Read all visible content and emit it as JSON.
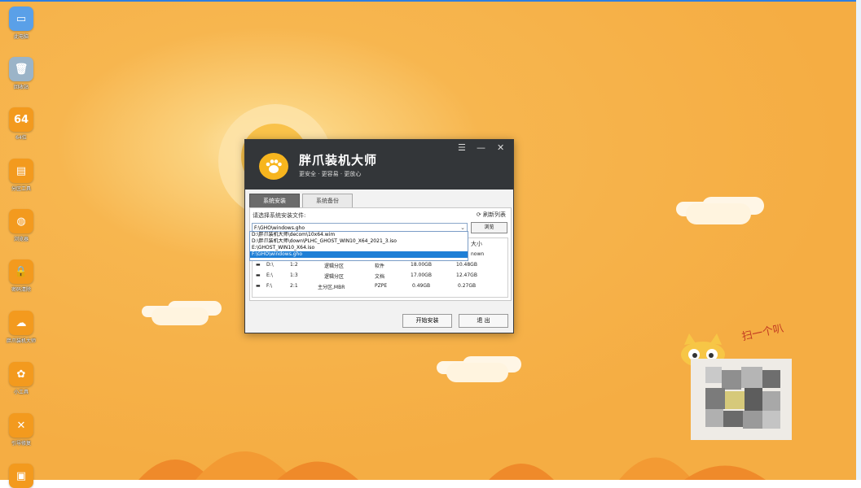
{
  "desktop_icons": [
    {
      "label": "此电脑",
      "icon": "computer-icon",
      "glyph": "▭"
    },
    {
      "label": "回收站",
      "icon": "recycle-bin-icon",
      "glyph": "🗑"
    },
    {
      "label": "64位",
      "icon": "64bit-icon",
      "glyph": "64"
    },
    {
      "label": "分区工具",
      "icon": "disk-icon",
      "glyph": "▤"
    },
    {
      "label": "浏览器",
      "icon": "globe-icon",
      "glyph": "◍"
    },
    {
      "label": "密码清除",
      "icon": "lock-icon",
      "glyph": "🔒"
    },
    {
      "label": "胖爪装机大师",
      "icon": "paw-icon",
      "glyph": "☁"
    },
    {
      "label": "小工具",
      "icon": "leaf-icon",
      "glyph": "✿"
    },
    {
      "label": "引导修复",
      "icon": "tools-icon",
      "glyph": "✕"
    },
    {
      "label": "远程",
      "icon": "remote-icon",
      "glyph": "▣"
    }
  ],
  "window": {
    "title": "胖爪装机大师",
    "subtitle": "更安全 · 更容易 · 更放心",
    "tabs": [
      {
        "label": "系统安装",
        "active": true
      },
      {
        "label": "系统备份",
        "active": false
      }
    ],
    "prompt": "请选择系统安装文件:",
    "refresh_label": "刷新列表",
    "combo_value": "F:\\GHO\\windows.gho",
    "browse_label": "浏览",
    "dropdown_options": [
      "D:\\胖爪装机大师\\decom\\10x64.wim",
      "D:\\胖爪装机大师\\down\\PLHC_GHOST_WIN10_X64_2021_3.iso",
      "E:\\GHOST_WIN10_X64.iso",
      "F:\\GHO\\windows.gho"
    ],
    "dropdown_selected": 3,
    "table_header_size": "大小",
    "table_partial_row": "nown",
    "table_rows": [
      {
        "drive": "D:\\",
        "index": "1:2",
        "type": "逻辑分区",
        "label": "软件",
        "total": "18.00GB",
        "free": "10.48GB"
      },
      {
        "drive": "E:\\",
        "index": "1:3",
        "type": "逻辑分区",
        "label": "文档",
        "total": "17.00GB",
        "free": "12.47GB"
      },
      {
        "drive": "F:\\",
        "index": "2:1",
        "type": "主分区,MBR",
        "label": "PZPE",
        "total": "0.49GB",
        "free": "0.27GB"
      }
    ],
    "start_button": "开始安装",
    "exit_button": "退 出"
  },
  "wallpaper": {
    "handwriting": "扫一个叭"
  },
  "colors": {
    "topline": "#2f7fe0",
    "window_header": "#333639",
    "selection": "#1e7fd6",
    "icon_tile": "#f39a1e"
  }
}
